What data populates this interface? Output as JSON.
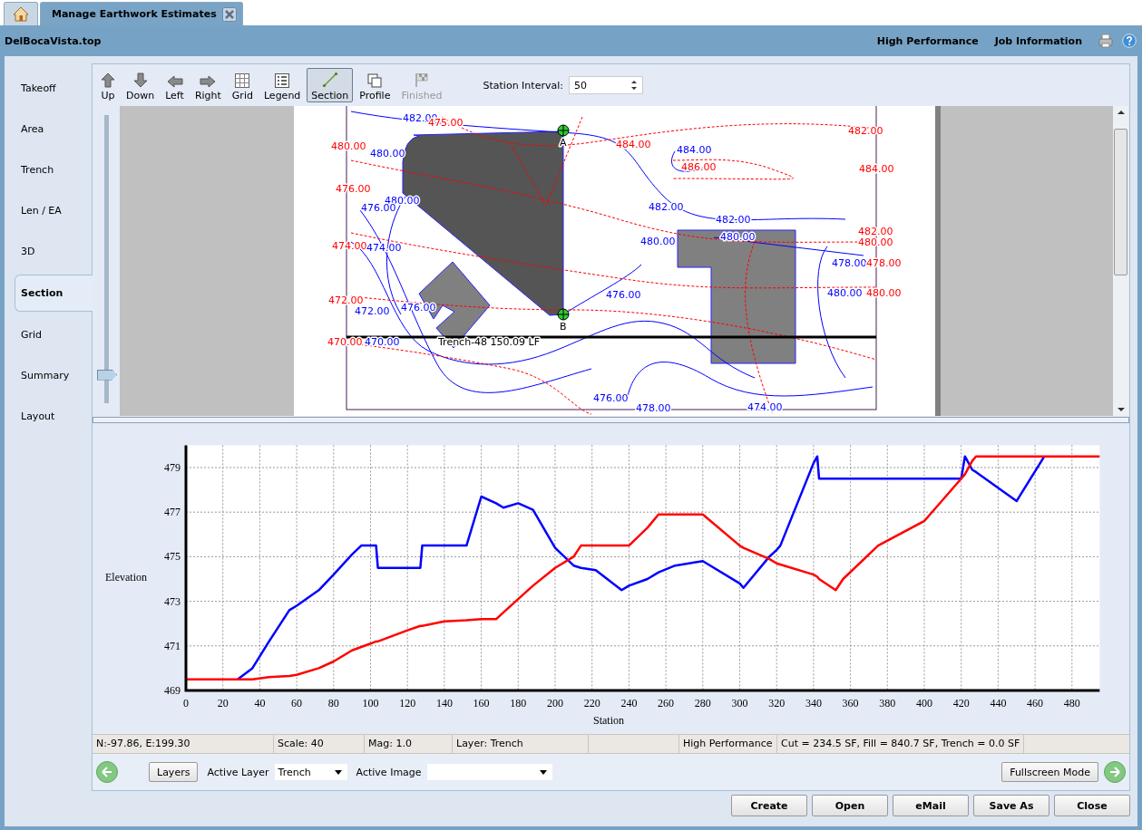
{
  "tabs": [
    {
      "kind": "home",
      "selected": false
    },
    {
      "kind": "page",
      "label": "Manage Earthwork Estimates",
      "selected": true
    }
  ],
  "header": {
    "file": "DelBocaVista.top",
    "links": [
      "High Performance",
      "Job Information"
    ]
  },
  "sidebar": {
    "items": [
      {
        "label": "Takeoff",
        "selected": false
      },
      {
        "label": "Area",
        "selected": false
      },
      {
        "label": "Trench",
        "selected": false
      },
      {
        "label": "Len / EA",
        "selected": false
      },
      {
        "label": "3D",
        "selected": false
      },
      {
        "label": "Section",
        "selected": true
      },
      {
        "label": "Grid",
        "selected": false
      },
      {
        "label": "Summary",
        "selected": false
      },
      {
        "label": "Layout",
        "selected": false
      }
    ]
  },
  "toolbar": {
    "buttons": [
      {
        "label": "Up",
        "selected": false,
        "disabled": false
      },
      {
        "label": "Down",
        "selected": false,
        "disabled": false
      },
      {
        "label": "Left",
        "selected": false,
        "disabled": false
      },
      {
        "label": "Right",
        "selected": false,
        "disabled": false
      },
      {
        "label": "Grid",
        "selected": false,
        "disabled": false
      },
      {
        "label": "Legend",
        "selected": false,
        "disabled": false
      },
      {
        "label": "Section",
        "selected": true,
        "disabled": false
      },
      {
        "label": "Profile",
        "selected": false,
        "disabled": false
      },
      {
        "label": "Finished",
        "selected": false,
        "disabled": true
      }
    ],
    "station_interval": {
      "label": "Station Interval:",
      "value": "50"
    }
  },
  "map": {
    "zoom_slider": {
      "level": 0.08
    },
    "labels": [
      {
        "text": "482.00",
        "color": "#0000ff"
      },
      {
        "text": "475.00",
        "color": "#ff0000"
      },
      {
        "text": "480.00",
        "color": "#ff0000"
      },
      {
        "text": "480.00",
        "color": "#0000ff"
      },
      {
        "text": "484.00",
        "color": "#ff0000"
      },
      {
        "text": "484.00",
        "color": "#0000ff"
      },
      {
        "text": "486.00",
        "color": "#ff0000"
      },
      {
        "text": "482.00",
        "color": "#ff0000"
      },
      {
        "text": "484.00",
        "color": "#ff0000"
      },
      {
        "text": "476.00",
        "color": "#ff0000"
      },
      {
        "text": "480.00",
        "color": "#0000ff"
      },
      {
        "text": "476.00",
        "color": "#0000ff"
      },
      {
        "text": "482.00",
        "color": "#0000ff"
      },
      {
        "text": "482.00",
        "color": "#0000ff"
      },
      {
        "text": "474.00",
        "color": "#ff0000"
      },
      {
        "text": "474.00",
        "color": "#0000ff"
      },
      {
        "text": "480.00",
        "color": "#0000ff"
      },
      {
        "text": "480.00",
        "color": "#0000ff"
      },
      {
        "text": "482.00",
        "color": "#ff0000"
      },
      {
        "text": "480.00",
        "color": "#ff0000"
      },
      {
        "text": "478.00",
        "color": "#0000ff"
      },
      {
        "text": "478.00",
        "color": "#ff0000"
      },
      {
        "text": "476.00",
        "color": "#0000ff"
      },
      {
        "text": "480.00",
        "color": "#0000ff"
      },
      {
        "text": "480.00",
        "color": "#ff0000"
      },
      {
        "text": "472.00",
        "color": "#ff0000"
      },
      {
        "text": "472.00",
        "color": "#0000ff"
      },
      {
        "text": "476.00",
        "color": "#0000ff"
      },
      {
        "text": "470.00",
        "color": "#ff0000"
      },
      {
        "text": "470.00",
        "color": "#0000ff"
      },
      {
        "text": "476.00",
        "color": "#0000ff"
      },
      {
        "text": "478.00",
        "color": "#0000ff"
      },
      {
        "text": "474.00",
        "color": "#0000ff"
      }
    ],
    "markers": [
      "A",
      "B"
    ],
    "trench_label": "Trench-48 150.09 LF"
  },
  "profile": {
    "chart_data": {
      "type": "line",
      "grid": true,
      "xlabel": "Station",
      "ylabel": "Elevation",
      "xlim": [
        0,
        495
      ],
      "ylim": [
        469,
        480
      ],
      "xticks": [
        0,
        20,
        40,
        60,
        80,
        100,
        120,
        140,
        160,
        180,
        200,
        220,
        240,
        260,
        280,
        300,
        320,
        340,
        360,
        380,
        400,
        420,
        440,
        460,
        480
      ],
      "yticks": [
        469,
        471,
        473,
        475,
        477,
        479
      ],
      "x": [
        0,
        28,
        36,
        45,
        56,
        60,
        72,
        80,
        90,
        95,
        100,
        103,
        104,
        120,
        127,
        128,
        140,
        152,
        160,
        168,
        172,
        180,
        188,
        200,
        210,
        214,
        222,
        236,
        240,
        250,
        256,
        265,
        280,
        300,
        302,
        316,
        320,
        322,
        340,
        342,
        343,
        352,
        356,
        375,
        400,
        420,
        422,
        426,
        428,
        450,
        465,
        495
      ],
      "series": [
        {
          "color": "#0000ff",
          "values": [
            null,
            469.5,
            470,
            471.2,
            472.6,
            472.8,
            473.5,
            474.2,
            475.1,
            475.5,
            475.5,
            475.5,
            474.5,
            474.5,
            474.5,
            475.5,
            475.5,
            475.5,
            477.7,
            477.4,
            477.2,
            477.4,
            477.1,
            475.4,
            474.6,
            474.5,
            474.4,
            473.5,
            473.7,
            474,
            474.3,
            474.6,
            474.8,
            473.8,
            473.6,
            475,
            475.3,
            475.5,
            479.2,
            479.5,
            478.5,
            478.5,
            478.5,
            478.5,
            478.5,
            478.5,
            479.5,
            478.9,
            478.8,
            477.5,
            479.5,
            null
          ]
        },
        {
          "color": "#ff0000",
          "values": [
            469.5,
            469.5,
            469.5,
            469.6,
            469.65,
            469.7,
            470,
            470.3,
            470.8,
            470.95,
            471.1,
            471.2,
            471.2,
            471.7,
            471.9,
            471.9,
            472.1,
            472.15,
            472.2,
            472.2,
            472.5,
            473.1,
            473.7,
            474.5,
            475,
            475.5,
            475.5,
            475.5,
            475.5,
            476.3,
            476.9,
            476.9,
            476.9,
            475.5,
            475.4,
            474.9,
            474.7,
            474.65,
            474.2,
            474.1,
            474,
            473.5,
            474,
            475.5,
            476.6,
            478.5,
            478.7,
            479.3,
            479.5,
            479.5,
            479.5,
            479.5
          ]
        }
      ]
    }
  },
  "status_bar": [
    "N:-97.86, E:199.30",
    "Scale:  40",
    "Mag: 1.0",
    "Layer: Trench",
    "High Performance",
    "Cut = 234.5 SF, Fill = 840.7 SF, Trench = 0.0 SF"
  ],
  "controls": {
    "layers_button": "Layers",
    "active_layer": {
      "label": "Active Layer",
      "value": "Trench"
    },
    "active_image": {
      "label": "Active Image"
    },
    "fullscreen_button": "Fullscreen Mode"
  },
  "buttons": [
    "Create",
    "Open",
    "eMail",
    "Save As",
    "Close"
  ]
}
